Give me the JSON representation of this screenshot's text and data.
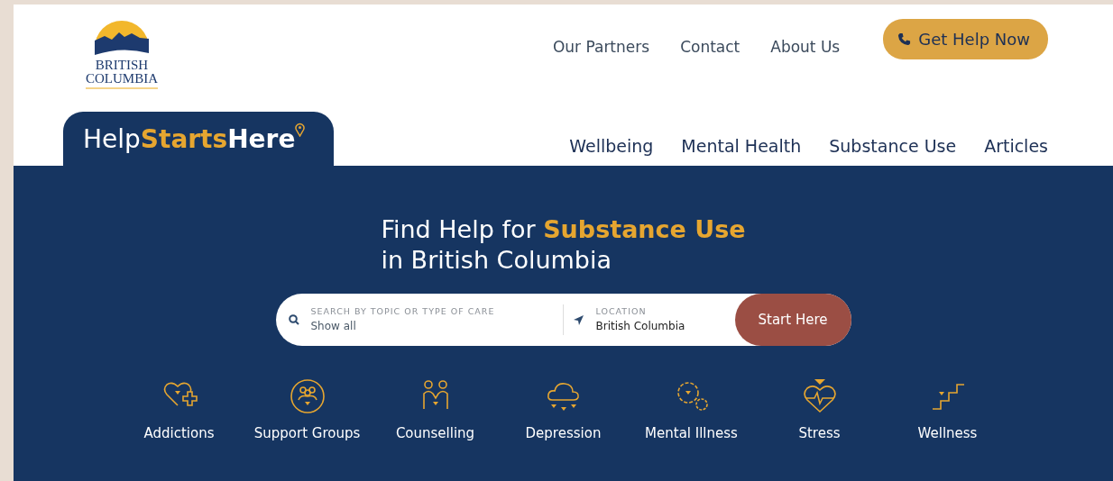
{
  "logo": {
    "line1": "BRITISH",
    "line2": "COLUMBIA"
  },
  "top_nav": [
    "Our Partners",
    "Contact",
    "About Us"
  ],
  "help_button": {
    "label": "Get Help Now"
  },
  "brand": {
    "regular": "Help",
    "highlight": "Starts",
    "bold": "Here"
  },
  "main_nav": [
    "Wellbeing",
    "Mental Health",
    "Substance Use",
    "Articles"
  ],
  "hero": {
    "title": "Find Help for **Substance Use**",
    "subtitle": "in British Columbia"
  },
  "search": {
    "topic_label": "SEARCH BY TOPIC OR TYPE OF CARE",
    "topic_value": "Show all",
    "location_label": "LOCATION",
    "location_value": "British Columbia",
    "button": "Start Here"
  },
  "categories": [
    "Addictions",
    "Support Groups",
    "Counselling",
    "Depression",
    "Mental Illness",
    "Stress",
    "Wellness"
  ]
}
